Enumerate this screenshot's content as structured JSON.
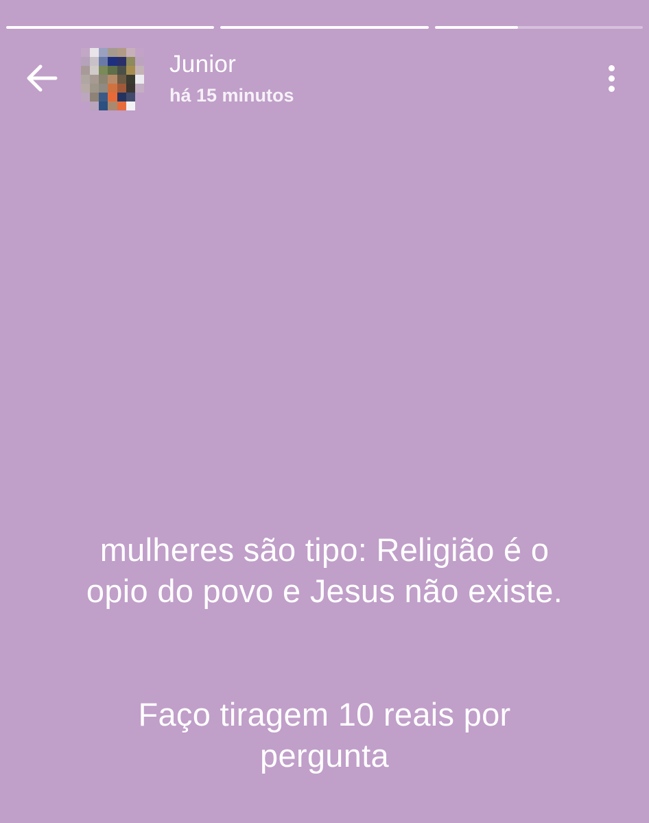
{
  "story": {
    "background_color": "#c09fc9",
    "progress": [
      1.0,
      1.0,
      0.4
    ]
  },
  "header": {
    "back_icon": "arrow-left-icon",
    "avatar_alt": "pixelated-avatar",
    "user_name": "Junior",
    "timestamp": "há 15 minutos",
    "menu_icon": "more-vertical-icon"
  },
  "content": {
    "line1": "mulheres são tipo: Religião é o",
    "line2": "opio do povo e Jesus não existe.",
    "line3": "Faço tiragem 10 reais por",
    "line4": "pergunta"
  }
}
